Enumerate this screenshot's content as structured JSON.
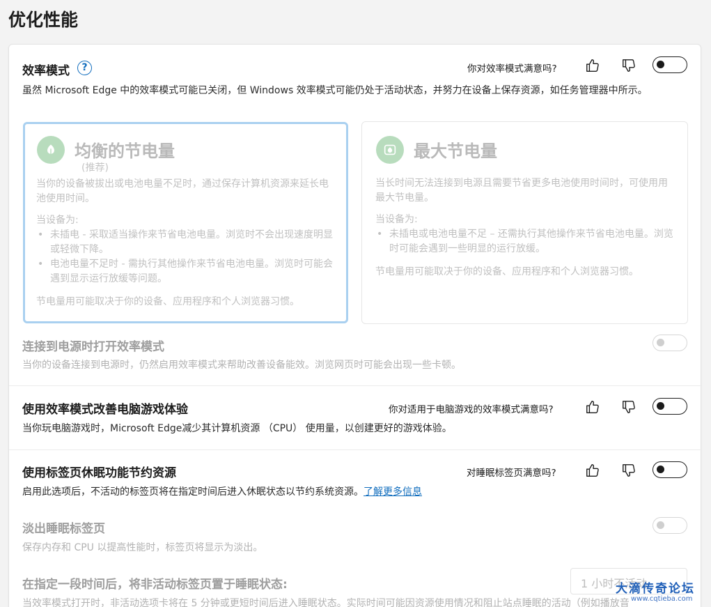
{
  "page": {
    "title": "优化性能"
  },
  "efficiency": {
    "title": "效率模式",
    "feedback_question": "你对效率模式满意吗?",
    "description": "虽然 Microsoft Edge 中的效率模式可能已关闭，但 Windows 效率模式可能仍处于活动状态，并努力在设备上保存资源，如任务管理器中所示。",
    "toggle_on": false
  },
  "options": [
    {
      "title": "均衡的节电量",
      "subtitle": "(推荐)",
      "description": "当你的设备被拔出或电池电量不足时，通过保存计算机资源来延长电池使用时间。",
      "when_label": "当设备为:",
      "bullets": [
        "未插电 - 采取适当操作来节省电池电量。浏览时不会出现速度明显或轻微下降。",
        "电池电量不足时 - 需执行其他操作来节省电池电量。浏览时可能会遇到显示运行放缓等问题。"
      ],
      "note": "节电量用可能取决于你的设备、应用程序和个人浏览器习惯。",
      "selected": true
    },
    {
      "title": "最大节电量",
      "subtitle": "",
      "description": "当长时间无法连接到电源且需要节省更多电池使用时间时，可使用用最大节电量。",
      "when_label": "当设备为:",
      "bullets": [
        "未插电或电池电量不足 – 还需执行其他操作来节省电池电量。浏览时可能会遇到一些明显的运行放缓。"
      ],
      "note": "节电量用可能取决于你的设备、应用程序和个人浏览器习惯。",
      "selected": false
    }
  ],
  "power_connected": {
    "title": "连接到电源时打开效率模式",
    "description": "当你的设备连接到电源时，仍然启用效率模式来帮助改善设备能效。浏览网页时可能会出现一些卡顿。"
  },
  "gaming": {
    "title": "使用效率模式改善电脑游戏体验",
    "feedback_question": "你对适用于电脑游戏的效率模式满意吗?",
    "description": "当你玩电脑游戏时，Microsoft Edge减少其计算机资源 （CPU） 使用量，以创建更好的游戏体验。"
  },
  "sleeping_tabs": {
    "title": "使用标签页休眠功能节约资源",
    "feedback_question": "对睡眠标签页满意吗?",
    "description": "启用此选项后，不活动的标签页将在指定时间后进入休眠状态以节约系统资源。",
    "learn_more": "了解更多信息"
  },
  "fade_tabs": {
    "title": "淡出睡眠标签页",
    "description": "保存内存和 CPU 以提高性能时，标签页将显示为淡出。"
  },
  "sleep_after": {
    "title": "在指定一段时间后，将非活动标签页置于睡眠状态:",
    "select_value": "1 小时不活动",
    "description": "当效率模式打开时，非活动选项卡将在 5 分钟或更短时间后进入睡眠状态。实际时间可能因资源使用情况和阻止站点睡眠的活动（例如播放音"
  },
  "watermark": {
    "text": "大滴传奇论坛",
    "url": "www.cqtieba.com"
  },
  "icons": {
    "help": "?",
    "like": "thumbs-up-icon",
    "dislike": "thumbs-down-icon",
    "leaf": "leaf-icon",
    "battery_leaf": "battery-leaf-icon"
  },
  "colors": {
    "accent": "#0f6cbd",
    "option_icon_bg": "#b8dcbd",
    "selected_border": "#a9d0f0"
  }
}
